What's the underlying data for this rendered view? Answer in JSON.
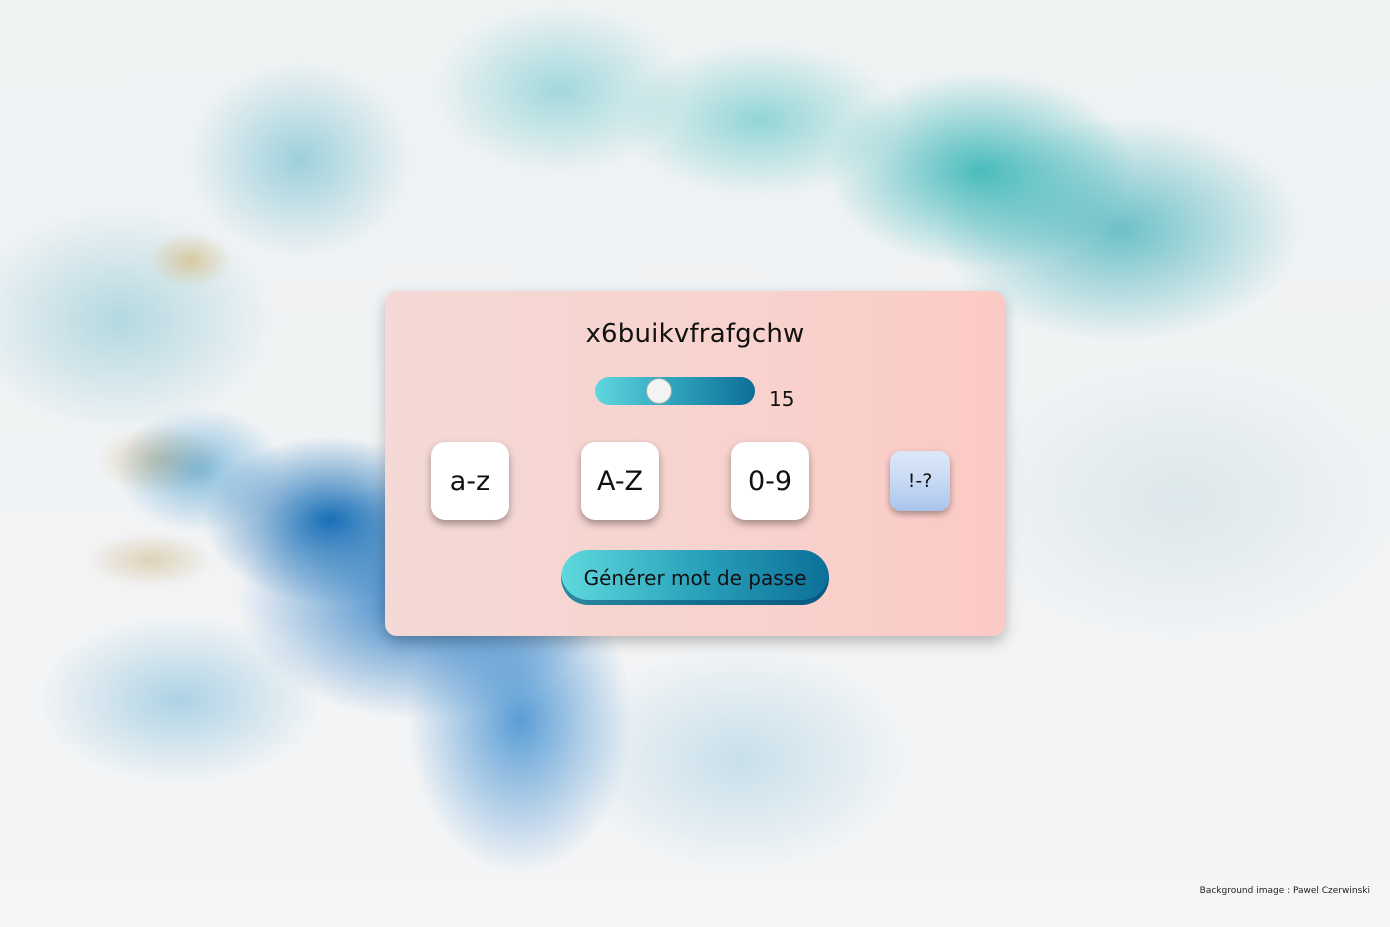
{
  "generator": {
    "password": "x6buikvfrafgchw",
    "length": {
      "value": "15",
      "min": 6,
      "max": 30,
      "fraction": 0.38
    },
    "options": [
      {
        "label": "a-z",
        "selected": true
      },
      {
        "label": "A-Z",
        "selected": true
      },
      {
        "label": "0-9",
        "selected": true
      },
      {
        "label": "!-?",
        "selected": false
      }
    ],
    "generate_label": "Générer mot de passe"
  },
  "footer": {
    "credit": "Background image : Pawel Czerwinski"
  },
  "colors": {
    "card_bg": "#f8d2cd",
    "accent_start": "#5fd9de",
    "accent_end": "#0c6f98",
    "option_bg": "#ffffff",
    "option_inactive_bg": "#c5d8f3"
  }
}
